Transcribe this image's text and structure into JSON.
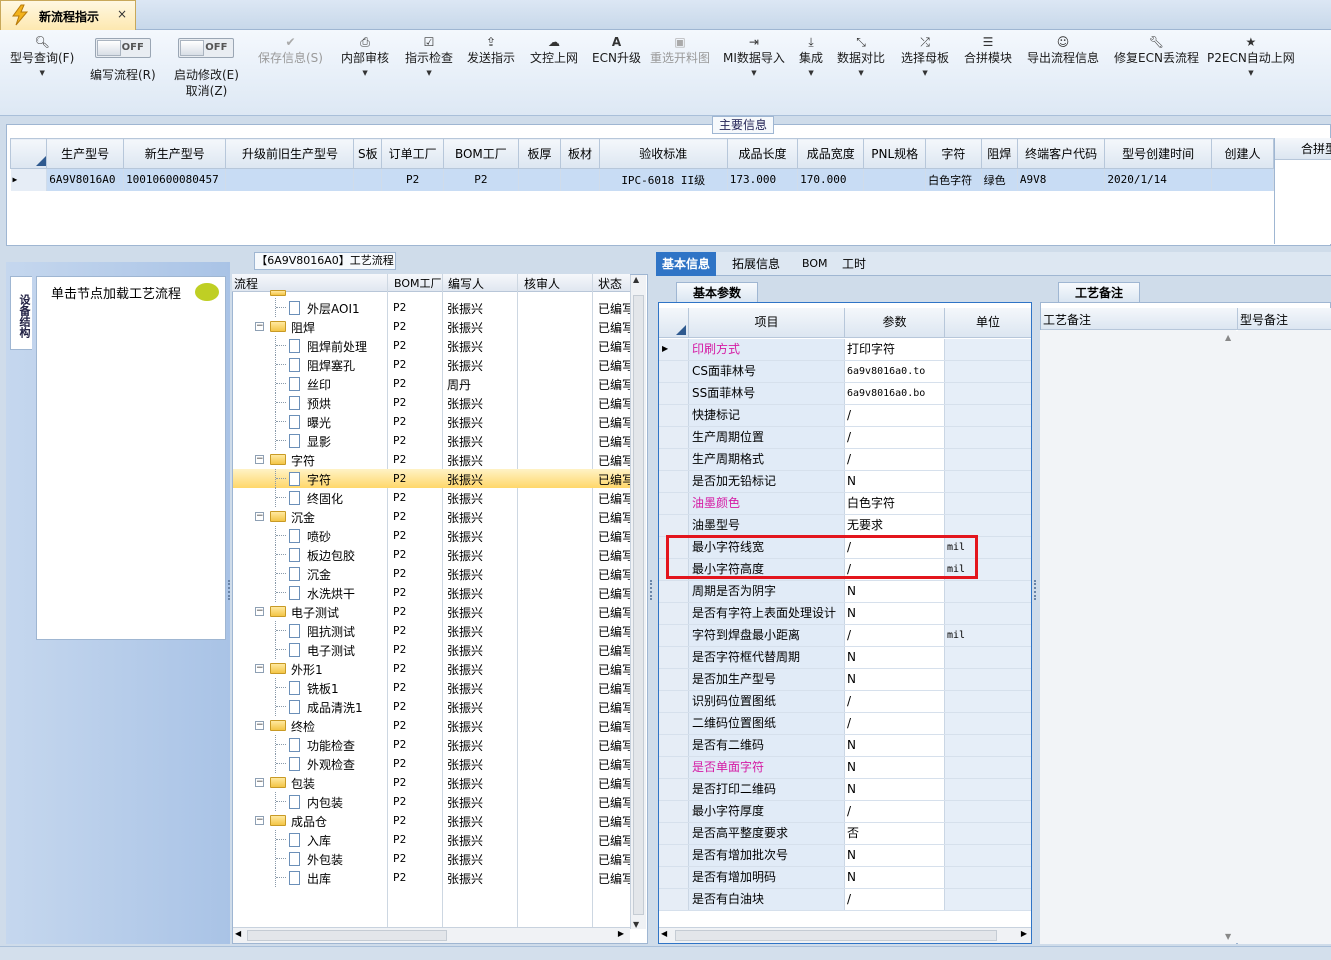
{
  "tab": {
    "title": "新流程指示",
    "close": "×"
  },
  "toolbar": {
    "items": [
      {
        "label": "型号查询(F)",
        "icon": "search-icon"
      },
      {
        "label": "编写流程(R)",
        "toggle": "OFF"
      },
      {
        "label": "启动修改(E)",
        "sub": "取消(Z)",
        "toggle": "OFF"
      },
      {
        "label": "保存信息(S)",
        "icon": "check-icon",
        "disabled": true
      },
      {
        "label": "内部审核",
        "icon": "printer-icon"
      },
      {
        "label": "指示检查",
        "icon": "checkbox-icon"
      },
      {
        "label": "发送指示",
        "icon": "upload-icon"
      },
      {
        "label": "文控上网",
        "icon": "cloud-icon"
      },
      {
        "label": "ECN升级",
        "icon": "font-icon"
      },
      {
        "label": "重选开料图",
        "icon": "image-icon",
        "disabled": true
      },
      {
        "label": "MI数据导入",
        "icon": "signin-icon"
      },
      {
        "label": "集成",
        "icon": "download-icon"
      },
      {
        "label": "数据对比",
        "icon": "compress-icon"
      },
      {
        "label": "选择母板",
        "icon": "shuffle-icon"
      },
      {
        "label": "合拼模块",
        "icon": "list-icon"
      },
      {
        "label": "导出流程信息",
        "icon": "smile-icon"
      },
      {
        "label": "修复ECN丢流程",
        "icon": "wrench-icon"
      },
      {
        "label": "P2ECN自动上网",
        "icon": "star-icon"
      }
    ]
  },
  "main_info": {
    "label": "主要信息",
    "columns": [
      "生产型号",
      "新生产型号",
      "升级前旧生产型号",
      "S板",
      "订单工厂",
      "BOM工厂",
      "板厚",
      "板材",
      "验收标准",
      "成品长度",
      "成品宽度",
      "PNL规格",
      "字符",
      "阻焊",
      "终端客户代码",
      "型号创建时间",
      "创建人"
    ],
    "row": [
      "6A9V8016A0",
      "10010600080457",
      "",
      "",
      "P2",
      "P2",
      "",
      "",
      "IPC-6018 II级",
      "173.000",
      "170.000",
      "",
      "白色字符",
      "绿色",
      "A9V8",
      "2020/1/14",
      ""
    ],
    "right_label": "合拼型"
  },
  "left_panel": {
    "vertical_tab": "设备结构",
    "load_text": "单击节点加载工艺流程"
  },
  "tree": {
    "label": "【6A9V8016A0】工艺流程",
    "columns": [
      "流程",
      "BOM工厂",
      "编写人",
      "核审人",
      "状态"
    ],
    "rows": [
      {
        "name": "外层AOI1",
        "level": 1,
        "folder": false,
        "bom": "P2",
        "author": "张振兴",
        "status": "已编写"
      },
      {
        "name": "阻焊",
        "level": 0,
        "folder": true,
        "bom": "P2",
        "author": "张振兴",
        "status": "已编写"
      },
      {
        "name": "阻焊前处理",
        "level": 1,
        "folder": false,
        "bom": "P2",
        "author": "张振兴",
        "status": "已编写"
      },
      {
        "name": "阻焊塞孔",
        "level": 1,
        "folder": false,
        "bom": "P2",
        "author": "张振兴",
        "status": "已编写"
      },
      {
        "name": "丝印",
        "level": 1,
        "folder": false,
        "bom": "P2",
        "author": "周丹",
        "status": "已编写"
      },
      {
        "name": "预烘",
        "level": 1,
        "folder": false,
        "bom": "P2",
        "author": "张振兴",
        "status": "已编写"
      },
      {
        "name": "曝光",
        "level": 1,
        "folder": false,
        "bom": "P2",
        "author": "张振兴",
        "status": "已编写"
      },
      {
        "name": "显影",
        "level": 1,
        "folder": false,
        "bom": "P2",
        "author": "张振兴",
        "status": "已编写"
      },
      {
        "name": "字符",
        "level": 0,
        "folder": true,
        "bom": "P2",
        "author": "张振兴",
        "status": "已编写"
      },
      {
        "name": "字符",
        "level": 1,
        "folder": false,
        "bom": "P2",
        "author": "张振兴",
        "status": "已编写",
        "selected": true
      },
      {
        "name": "终固化",
        "level": 1,
        "folder": false,
        "bom": "P2",
        "author": "张振兴",
        "status": "已编写"
      },
      {
        "name": "沉金",
        "level": 0,
        "folder": true,
        "bom": "P2",
        "author": "张振兴",
        "status": "已编写"
      },
      {
        "name": "喷砂",
        "level": 1,
        "folder": false,
        "bom": "P2",
        "author": "张振兴",
        "status": "已编写"
      },
      {
        "name": "板边包胶",
        "level": 1,
        "folder": false,
        "bom": "P2",
        "author": "张振兴",
        "status": "已编写"
      },
      {
        "name": "沉金",
        "level": 1,
        "folder": false,
        "bom": "P2",
        "author": "张振兴",
        "status": "已编写"
      },
      {
        "name": "水洗烘干",
        "level": 1,
        "folder": false,
        "bom": "P2",
        "author": "张振兴",
        "status": "已编写"
      },
      {
        "name": "电子测试",
        "level": 0,
        "folder": true,
        "bom": "P2",
        "author": "张振兴",
        "status": "已编写"
      },
      {
        "name": "阻抗测试",
        "level": 1,
        "folder": false,
        "bom": "P2",
        "author": "张振兴",
        "status": "已编写"
      },
      {
        "name": "电子测试",
        "level": 1,
        "folder": false,
        "bom": "P2",
        "author": "张振兴",
        "status": "已编写"
      },
      {
        "name": "外形1",
        "level": 0,
        "folder": true,
        "bom": "P2",
        "author": "张振兴",
        "status": "已编写"
      },
      {
        "name": "铣板1",
        "level": 1,
        "folder": false,
        "bom": "P2",
        "author": "张振兴",
        "status": "已编写"
      },
      {
        "name": "成品清洗1",
        "level": 1,
        "folder": false,
        "bom": "P2",
        "author": "张振兴",
        "status": "已编写"
      },
      {
        "name": "终检",
        "level": 0,
        "folder": true,
        "bom": "P2",
        "author": "张振兴",
        "status": "已编写"
      },
      {
        "name": "功能检查",
        "level": 1,
        "folder": false,
        "bom": "P2",
        "author": "张振兴",
        "status": "已编写"
      },
      {
        "name": "外观检查",
        "level": 1,
        "folder": false,
        "bom": "P2",
        "author": "张振兴",
        "status": "已编写"
      },
      {
        "name": "包装",
        "level": 0,
        "folder": true,
        "bom": "P2",
        "author": "张振兴",
        "status": "已编写"
      },
      {
        "name": "内包装",
        "level": 1,
        "folder": false,
        "bom": "P2",
        "author": "张振兴",
        "status": "已编写"
      },
      {
        "name": "成品仓",
        "level": 0,
        "folder": true,
        "bom": "P2",
        "author": "张振兴",
        "status": "已编写"
      },
      {
        "name": "入库",
        "level": 1,
        "folder": false,
        "bom": "P2",
        "author": "张振兴",
        "status": "已编写"
      },
      {
        "name": "外包装",
        "level": 1,
        "folder": false,
        "bom": "P2",
        "author": "张振兴",
        "status": "已编写"
      },
      {
        "name": "出库",
        "level": 1,
        "folder": false,
        "bom": "P2",
        "author": "张振兴",
        "status": "已编写"
      }
    ]
  },
  "right_tabs": [
    "基本信息",
    "拓展信息",
    "BOM",
    "工时"
  ],
  "params": {
    "tab": "基本参数",
    "columns": [
      "项目",
      "参数",
      "单位"
    ],
    "rows": [
      {
        "item": "印刷方式",
        "value": "打印字符",
        "unit": "",
        "highlight": true,
        "current": true
      },
      {
        "item": "CS面菲林号",
        "value": "6a9v8016a0.to",
        "unit": ""
      },
      {
        "item": "SS面菲林号",
        "value": "6a9v8016a0.bo",
        "unit": ""
      },
      {
        "item": "快捷标记",
        "value": "/",
        "unit": ""
      },
      {
        "item": "生产周期位置",
        "value": "/",
        "unit": ""
      },
      {
        "item": "生产周期格式",
        "value": "/",
        "unit": ""
      },
      {
        "item": "是否加无铅标记",
        "value": "N",
        "unit": ""
      },
      {
        "item": "油墨颜色",
        "value": "白色字符",
        "unit": "",
        "highlight": true
      },
      {
        "item": "油墨型号",
        "value": "无要求",
        "unit": ""
      },
      {
        "item": "最小字符线宽",
        "value": "/",
        "unit": "mil"
      },
      {
        "item": "最小字符高度",
        "value": "/",
        "unit": "mil"
      },
      {
        "item": "周期是否为阴字",
        "value": "N",
        "unit": ""
      },
      {
        "item": "是否有字符上表面处理设计",
        "value": "N",
        "unit": ""
      },
      {
        "item": "字符到焊盘最小距离",
        "value": "/",
        "unit": "mil"
      },
      {
        "item": "是否字符框代替周期",
        "value": "N",
        "unit": ""
      },
      {
        "item": "是否加生产型号",
        "value": "N",
        "unit": ""
      },
      {
        "item": "识别码位置图纸",
        "value": "/",
        "unit": ""
      },
      {
        "item": "二维码位置图纸",
        "value": "/",
        "unit": ""
      },
      {
        "item": "是否有二维码",
        "value": "N",
        "unit": ""
      },
      {
        "item": "是否单面字符",
        "value": "N",
        "unit": "",
        "highlight": true
      },
      {
        "item": "是否打印二维码",
        "value": "N",
        "unit": ""
      },
      {
        "item": "最小字符厚度",
        "value": "/",
        "unit": ""
      },
      {
        "item": "是否高平整度要求",
        "value": "否",
        "unit": ""
      },
      {
        "item": "是否有增加批次号",
        "value": "N",
        "unit": ""
      },
      {
        "item": "是否有增加明码",
        "value": "N",
        "unit": ""
      },
      {
        "item": "是否有白油块",
        "value": "/",
        "unit": ""
      }
    ]
  },
  "notes": {
    "tab": "工艺备注",
    "col1": "工艺备注",
    "col2": "型号备注"
  },
  "colors": {
    "accent": "#2f74c6",
    "selection": "#c8dcf4",
    "highlight_text": "#d51aa4",
    "callout": "#e3151d"
  }
}
